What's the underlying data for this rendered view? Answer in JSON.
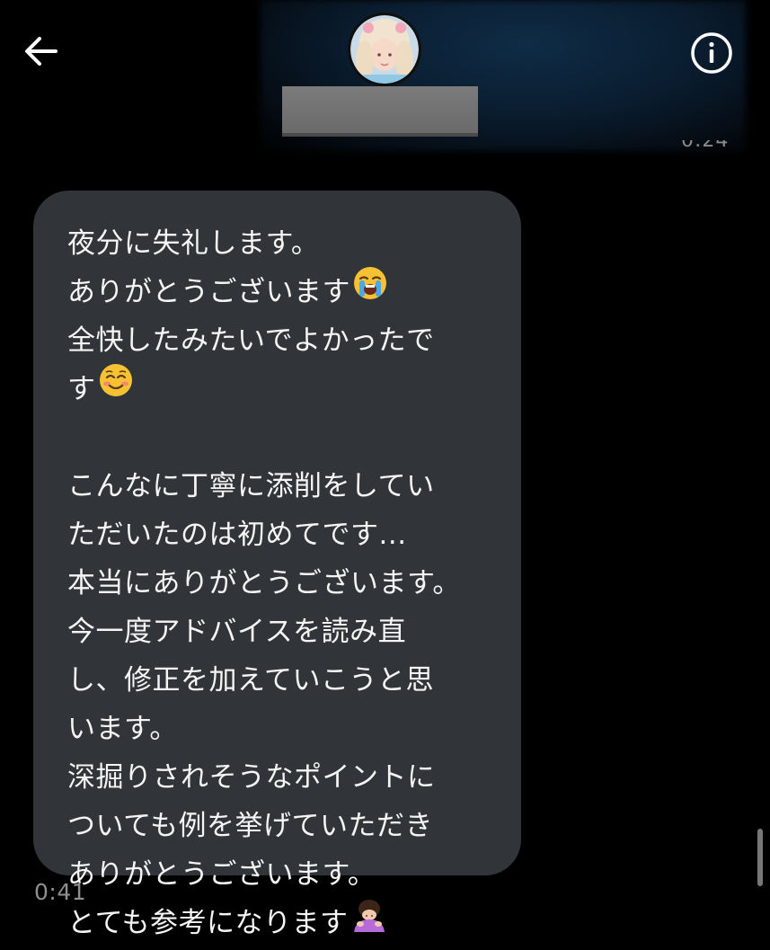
{
  "header": {
    "back_icon": "arrow-left-icon",
    "info_icon": "info-circle-icon",
    "contact_name": "",
    "previous_message_time": "0:24"
  },
  "message": {
    "lines": [
      "夜分に失礼します。",
      "ありがとうございます",
      "全快したみたいでよかったで",
      "す",
      "",
      "こんなに丁寧に添削をしてい",
      "ただいたのは初めてです...",
      "本当にありがとうございます。",
      "今一度アドバイスを読み直",
      "し、修正を加えていこうと思",
      "います。",
      "深掘りされそうなポイントに",
      "ついても例を挙げていただき",
      "ありがとうございます。",
      "とても参考になります"
    ],
    "emojis": {
      "line_1": "loudly-crying-face-emoji",
      "line_3": "smiling-face-emoji",
      "line_14": "person-bowing-emoji"
    },
    "time": "0:41"
  },
  "colors": {
    "background": "#000000",
    "bubble": "#313438",
    "text": "#f5f5f5",
    "timestamp": "#8f8f8f",
    "header_glow": "#0f2c46"
  }
}
